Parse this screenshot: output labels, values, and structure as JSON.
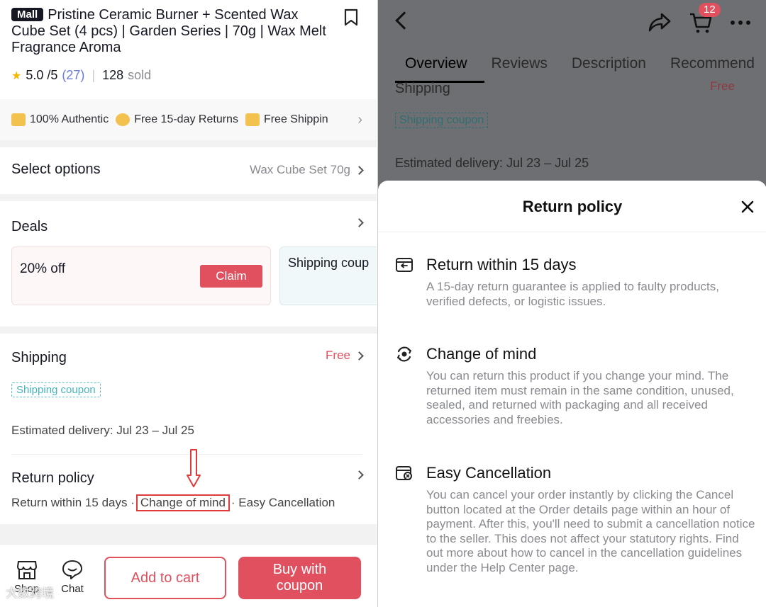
{
  "left": {
    "badge": "Mall",
    "product_title": "Pristine Ceramic Burner + Scented Wax Cube Set (4 pcs) | Garden Series | 70g | Wax Melt Fragrance Aroma",
    "rating": "5.0 /5",
    "rating_count": "(27)",
    "sold": "128",
    "sold_label": "sold",
    "features": [
      "100% Authentic",
      "Free 15-day Returns",
      "Free Shippin"
    ],
    "select_options": {
      "label": "Select options",
      "value": "Wax Cube Set 70g"
    },
    "deals": {
      "label": "Deals",
      "card1_text": "20% off",
      "claim_label": "Claim",
      "card2_text": "Shipping coup"
    },
    "shipping": {
      "label": "Shipping",
      "price": "Free",
      "coupon": "Shipping coupon",
      "estimated": "Estimated delivery: Jul 23 – Jul 25"
    },
    "return_policy": {
      "label": "Return policy",
      "item1": "Return within 15 days ·",
      "item2": "Change of mind",
      "item3": "· Easy Cancellation"
    },
    "bottom": {
      "shop_label": "Shop",
      "chat_label": "Chat",
      "add_to_cart": "Add to cart",
      "buy_line1": "Buy with",
      "buy_line2": "coupon"
    },
    "watermark": "大数跨境"
  },
  "right": {
    "cart_count": "12",
    "tabs": [
      "Overview",
      "Reviews",
      "Description",
      "Recommend"
    ],
    "bg_shipping": "Shipping",
    "bg_free": "Free",
    "bg_coupon": "Shipping coupon",
    "bg_estimated": "Estimated delivery: Jul 23 – Jul 25",
    "sheet": {
      "title": "Return policy",
      "policies": [
        {
          "icon": "return-box-icon",
          "title": "Return within 15 days",
          "desc": "A 15-day return guarantee is applied to faulty products, verified defects, or logistic issues."
        },
        {
          "icon": "change-of-mind-icon",
          "title": "Change of mind",
          "desc": "You can return this product if you change your mind. The returned item must remain in the same condition, unused, sealed, and returned with packaging and all received accessories and freebies."
        },
        {
          "icon": "cancel-order-icon",
          "title": "Easy Cancellation",
          "desc": "You can cancel your order instantly by clicking the Cancel button located at the Order details page within an hour of payment. After this, you'll need to submit a cancellation notice to the seller. This does not affect your statutory rights. Find out more about how to cancel in the cancellation guidelines under the Help Center page."
        }
      ]
    }
  },
  "colors": {
    "accent": "#e0505f",
    "coupon_teal": "#49b3bb",
    "highlight_red": "#e03a3a"
  }
}
